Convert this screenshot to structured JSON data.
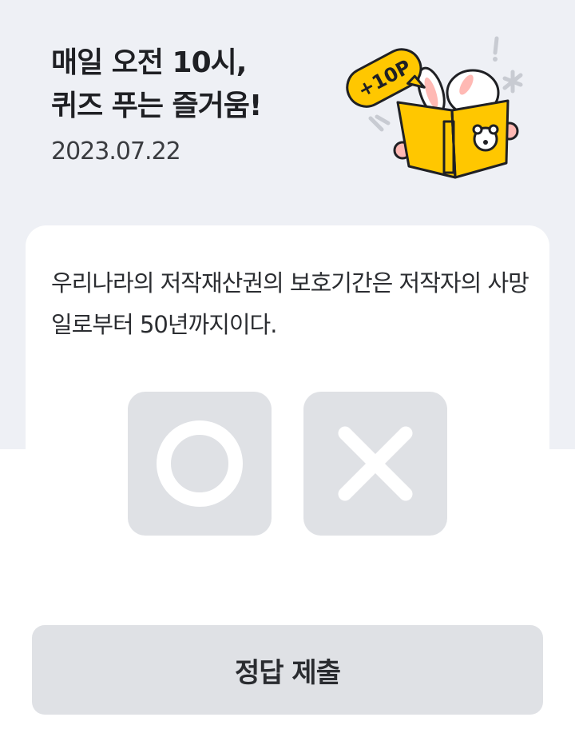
{
  "header": {
    "title_line1": "매일 오전 10시,",
    "title_line2": "퀴즈 푸는 즐거움!",
    "date": "2023.07.22",
    "points_badge": "+10P"
  },
  "quiz": {
    "question": "우리나라의 저작재산권의 보호기간은 저작자의 사망일로부터 50년까지이다.",
    "choices": [
      {
        "id": "O",
        "icon": "circle-o-icon"
      },
      {
        "id": "X",
        "icon": "cross-x-icon"
      }
    ]
  },
  "submit": {
    "label": "정답 제출"
  },
  "colors": {
    "header_bg": "#eef0f5",
    "choice_bg": "#dfe1e5",
    "button_bg": "#dfe1e5",
    "badge_yellow": "#ffc700",
    "text": "#1f2024"
  }
}
